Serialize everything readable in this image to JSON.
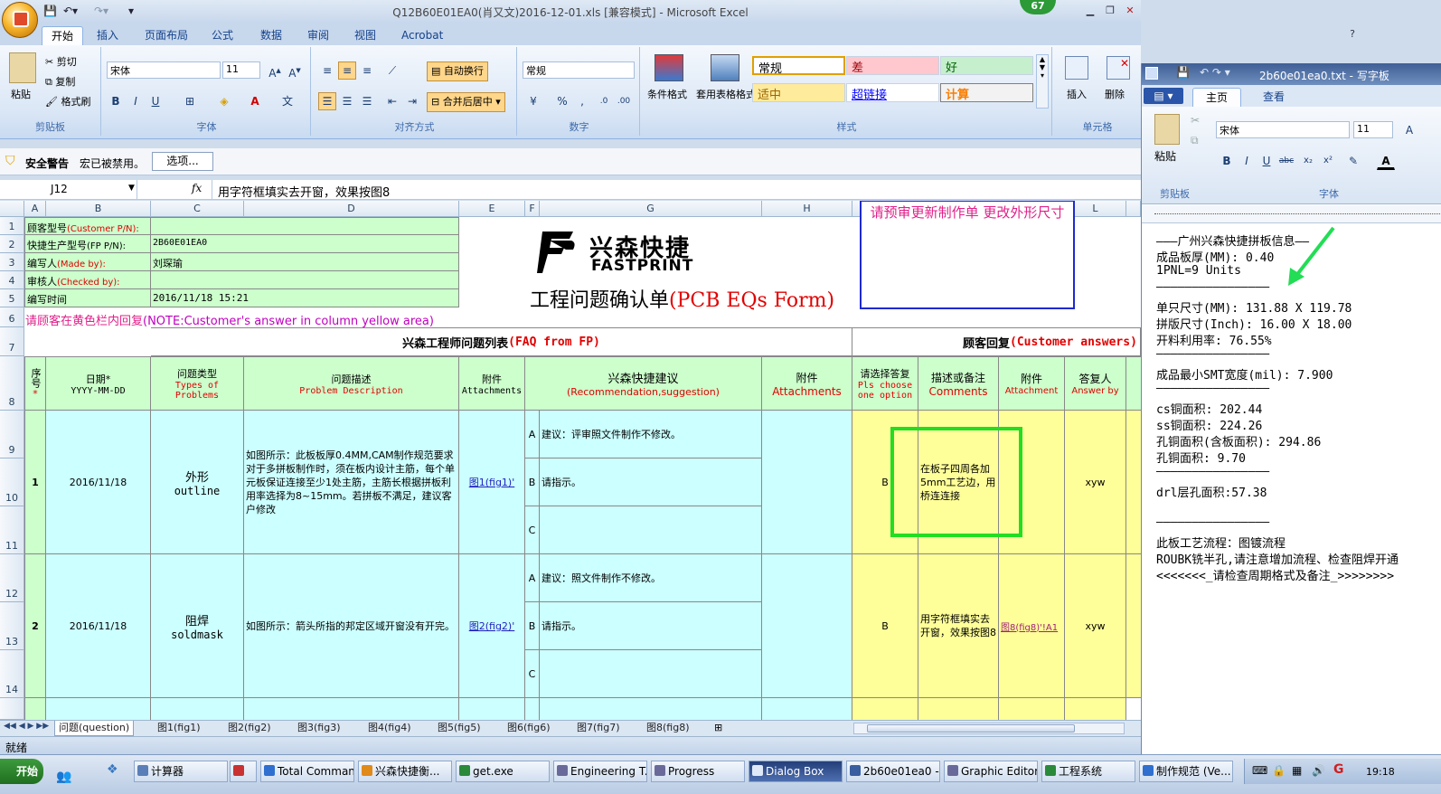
{
  "excel": {
    "title": "Q12B60E01EA0(肖又文)2016-12-01.xls  [兼容模式] - Microsoft Excel",
    "badge": "67",
    "tabs": [
      "开始",
      "插入",
      "页面布局",
      "公式",
      "数据",
      "审阅",
      "视图",
      "Acrobat"
    ],
    "ribbon": {
      "clipboard": {
        "paste": "粘贴",
        "cut": "剪切",
        "copy": "复制",
        "format_painter": "格式刷",
        "label": "剪贴板"
      },
      "font": {
        "name": "宋体",
        "size": "11",
        "label": "字体",
        "bold": "B",
        "italic": "I",
        "underline": "U"
      },
      "alignment": {
        "wrap": "自动换行",
        "merge": "合并后居中",
        "label": "对齐方式"
      },
      "number": {
        "format": "常规",
        "percent": "%",
        "comma": ",",
        "label": "数字"
      },
      "styles": {
        "conditional": "条件格式",
        "table_format": "套用表格格式",
        "label": "样式",
        "cells": [
          {
            "text": "常规",
            "bg": "#ffffff",
            "fg": "#000000"
          },
          {
            "text": "差",
            "bg": "#ffc7ce",
            "fg": "#9c0006"
          },
          {
            "text": "好",
            "bg": "#c6efce",
            "fg": "#006100"
          },
          {
            "text": "适中",
            "bg": "#ffeb9c",
            "fg": "#9c6500"
          },
          {
            "text": "超链接",
            "bg": "#ffffff",
            "fg": "#0000ff"
          },
          {
            "text": "计算",
            "bg": "#f2f2f2",
            "fg": "#fa7d00"
          }
        ]
      },
      "cells_group": {
        "insert": "插入",
        "delete": "删除",
        "label": "单元格"
      }
    },
    "security": {
      "title": "安全警告",
      "message": "宏已被禁用。",
      "button": "选项..."
    },
    "formula_bar": {
      "name_box": "J12",
      "fx": "fx",
      "content": "用字符框填实去开窗，效果按图8"
    },
    "columns": [
      "A",
      "B",
      "C",
      "D",
      "E",
      "F",
      "G",
      "H",
      "I",
      "J",
      "K",
      "L"
    ],
    "rows": [
      "1",
      "2",
      "3",
      "4",
      "5",
      "6",
      "7",
      "8",
      "9",
      "10",
      "11",
      "12",
      "13",
      "14"
    ],
    "header_info": [
      {
        "label": "顾客型号",
        "label_en": "(Customer P/N):",
        "value": ""
      },
      {
        "label": "快捷生产型号",
        "label_en": "(FP P/N):",
        "value": "2B60E01EA0"
      },
      {
        "label": "编写人",
        "label_en": "(Made by):",
        "value": "刘琛瑜"
      },
      {
        "label": "审核人",
        "label_en": "(Checked by):",
        "value": ""
      },
      {
        "label": "编写时间",
        "label_en": "",
        "value": "2016/11/18 15:21"
      }
    ],
    "note_cn": "请顾客在黄色栏内回复",
    "note_en": "(NOTE:Customer's answer in column yellow area)",
    "logo": {
      "cn": "兴森快捷",
      "en": "FASTPRINT"
    },
    "form_title_cn": "工程问题确认单",
    "form_title_en": "(PCB EQs Form)",
    "notice_box": "请预审更新制作单  更改外形尺寸",
    "section_fp": {
      "cn": "兴森工程师问题列表",
      "en": "(FAQ from FP)"
    },
    "section_customer": {
      "cn": "顾客回复",
      "en": "(Customer answers)"
    },
    "table_headers": {
      "seq": "序号",
      "star": "*",
      "date": "日期*",
      "date_fmt": "YYYY-MM-DD",
      "type_cn": "问题类型",
      "type_en": "Types of Problems",
      "desc_cn": "问题描述",
      "desc_en": "Problem Description",
      "attach_cn": "附件",
      "attach_en": "Attachments",
      "suggest_cn": "兴森快捷建议",
      "suggest_en": "(Recommendation,suggestion)",
      "attach2_cn": "附件",
      "attach2_en": "Attachments",
      "choose_cn": "请选择答复",
      "choose_en": "Pls choose one option",
      "comments_cn": "描述或备注",
      "comments_en": "Comments",
      "attach3_cn": "附件",
      "attach3_en": "Attachment",
      "answer_cn": "答复人",
      "answer_en": "Answer by"
    },
    "problems": [
      {
        "no": "1",
        "date": "2016/11/18",
        "type_cn": "外形",
        "type_en": "outline",
        "desc": "如图所示：此板板厚0.4MM,CAM制作规范要求对于多拼板制作时，须在板内设计主筋，每个单元板保证连接至少1处主筋，主筋长根据拼板利用率选择为8~15mm。若拼板不满足，建议客户修改",
        "attachment": "图1(fig1)'",
        "options": [
          {
            "letter": "A",
            "text": "建议：评审照文件制作不修改。"
          },
          {
            "letter": "B",
            "text": "请指示。"
          },
          {
            "letter": "C",
            "text": ""
          }
        ],
        "choice": "B",
        "comment": "在板子四周各加5mm工艺边，用桥连连接",
        "cust_attach": "",
        "answer_by": "xyw"
      },
      {
        "no": "2",
        "date": "2016/11/18",
        "type_cn": "阻焊",
        "type_en": "soldmask",
        "desc": "如图所示：箭头所指的邦定区域开窗没有开完。",
        "attachment": "图2(fig2)'",
        "options": [
          {
            "letter": "A",
            "text": "建议：照文件制作不修改。"
          },
          {
            "letter": "B",
            "text": "请指示。"
          },
          {
            "letter": "C",
            "text": ""
          }
        ],
        "choice": "B",
        "comment": "用字符框填实去开窗，效果按图8",
        "cust_attach": "图8(fig8)'!A1",
        "answer_by": "xyw"
      }
    ],
    "sheet_tabs": [
      "问题(question)",
      "图1(fig1)",
      "图2(fig2)",
      "图3(fig3)",
      "图4(fig4)",
      "图5(fig5)",
      "图6(fig6)",
      "图7(fig7)",
      "图8(fig8)"
    ],
    "status": "就绪"
  },
  "wordpad": {
    "title": "2b60e01ea0.txt - 写字板",
    "tabs": [
      "主页",
      "查看"
    ],
    "paste": "粘贴",
    "clipboard_label": "剪贴板",
    "font_label": "字体",
    "font_name": "宋体",
    "font_size": "11",
    "lines": [
      "———广州兴森快捷拼板信息——",
      "成品板厚(MM): 0.40",
      "1PNL=9 Units",
      "————————————————",
      "单只尺寸(MM): 131.88 X 119.78",
      "拼版尺寸(Inch): 16.00 X 18.00",
      "开料利用率: 76.55%",
      "————————————————",
      "成品最小SMT宽度(mil): 7.900",
      "————————————————",
      "cs铜面积: 202.44",
      "ss铜面积: 224.26",
      "孔铜面积(含板面积): 294.86",
      "孔铜面积: 9.70",
      "————————————————",
      "drl层孔面积:57.38",
      "",
      "————————————————",
      "此板工艺流程：图镀流程",
      "ROUBK铣半孔,请注意增加流程、检查阻焊开通",
      "<<<<<<<_请检查周期格式及备注_>>>>>>>>"
    ]
  },
  "taskbar": {
    "start": "开始",
    "items": [
      {
        "label": "计算器",
        "color": "#5a7fb8",
        "active": false
      },
      {
        "label": "",
        "color": "#c93232",
        "active": false
      },
      {
        "label": "Total Comman...",
        "color": "#2f6fcf",
        "active": false
      },
      {
        "label": "兴森快捷衡...",
        "color": "#e08a1a",
        "active": false
      },
      {
        "label": "get.exe",
        "color": "#2a8a3a",
        "active": false
      },
      {
        "label": "Engineering T...",
        "color": "#6a6a9a",
        "active": false
      },
      {
        "label": "Progress",
        "color": "#6a6a9a",
        "active": false
      },
      {
        "label": "Dialog Box",
        "color": "#6a6a9a",
        "active": true
      },
      {
        "label": "2b60e01ea0 -...",
        "color": "#3a5fa0",
        "active": false
      },
      {
        "label": "Graphic Editor...",
        "color": "#6a6a9a",
        "active": false
      },
      {
        "label": "工程系统",
        "color": "#2a8a3a",
        "active": false
      },
      {
        "label": "制作规范 (Ve...",
        "color": "#2f6fcf",
        "active": false
      }
    ],
    "clock": "19:18"
  }
}
